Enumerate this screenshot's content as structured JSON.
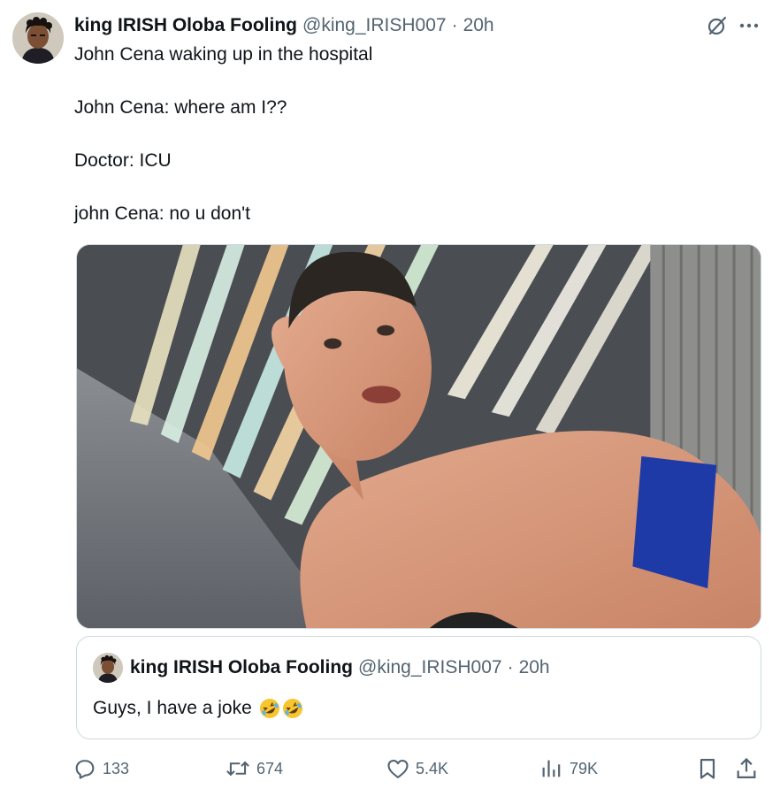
{
  "tweet": {
    "author_name": "king IRISH Oloba Fooling",
    "handle": "@king_IRISH007",
    "separator": "·",
    "time": "20h",
    "lines": [
      "John Cena waking up in the hospital",
      "John Cena: where am I??",
      "Doctor: ICU",
      "john Cena: no u don't"
    ]
  },
  "quote": {
    "author_name": "king IRISH Oloba Fooling",
    "handle": "@king_IRISH007",
    "separator": "·",
    "time": "20h",
    "text": "Guys, I have a joke",
    "emojis": [
      "rolling-on-floor-laughing",
      "rolling-on-floor-laughing"
    ]
  },
  "actions": {
    "replies": "133",
    "reposts": "674",
    "likes": "5.4K",
    "views": "79K"
  },
  "icons": {
    "grok": "grok-icon",
    "more": "more-icon",
    "reply": "reply-icon",
    "repost": "repost-icon",
    "like": "heart-icon",
    "views": "views-icon",
    "bookmark": "bookmark-icon",
    "share": "share-icon"
  },
  "colors": {
    "text": "#0f1419",
    "secondary": "#536471",
    "border": "#cfd9de"
  }
}
